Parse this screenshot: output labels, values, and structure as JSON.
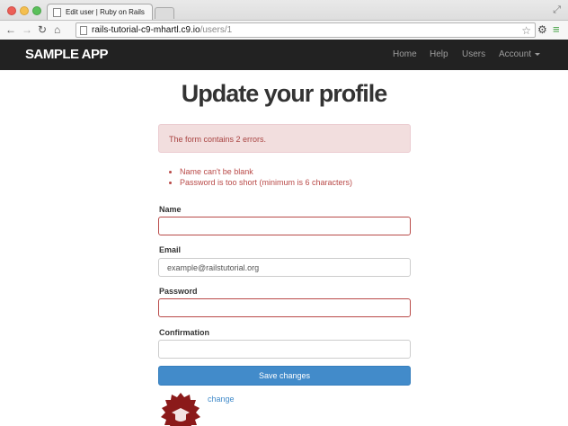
{
  "browser": {
    "tab_title": "Edit user | Ruby on Rails T",
    "url_host": "rails-tutorial-c9-mhartl.c9.io",
    "url_path": "/users/1"
  },
  "navbar": {
    "brand": "SAMPLE APP",
    "links": [
      "Home",
      "Help",
      "Users",
      "Account"
    ]
  },
  "page": {
    "title": "Update your profile",
    "alert": "The form contains 2 errors.",
    "errors": [
      "Name can't be blank",
      "Password is too short (minimum is 6 characters)"
    ]
  },
  "form": {
    "name_label": "Name",
    "name_value": "",
    "email_label": "Email",
    "email_value": "example@railstutorial.org",
    "password_label": "Password",
    "password_value": "",
    "confirmation_label": "Confirmation",
    "confirmation_value": "",
    "submit": "Save changes",
    "change_link": "change"
  },
  "colors": {
    "navbar_bg": "#222222",
    "primary": "#428bca",
    "error": "#b94a48",
    "alert_bg": "#f2dede"
  },
  "icons": [
    "back-icon",
    "forward-icon",
    "reload-icon",
    "home-icon",
    "star-icon",
    "gear-icon",
    "menu-icon",
    "resize-icon"
  ]
}
